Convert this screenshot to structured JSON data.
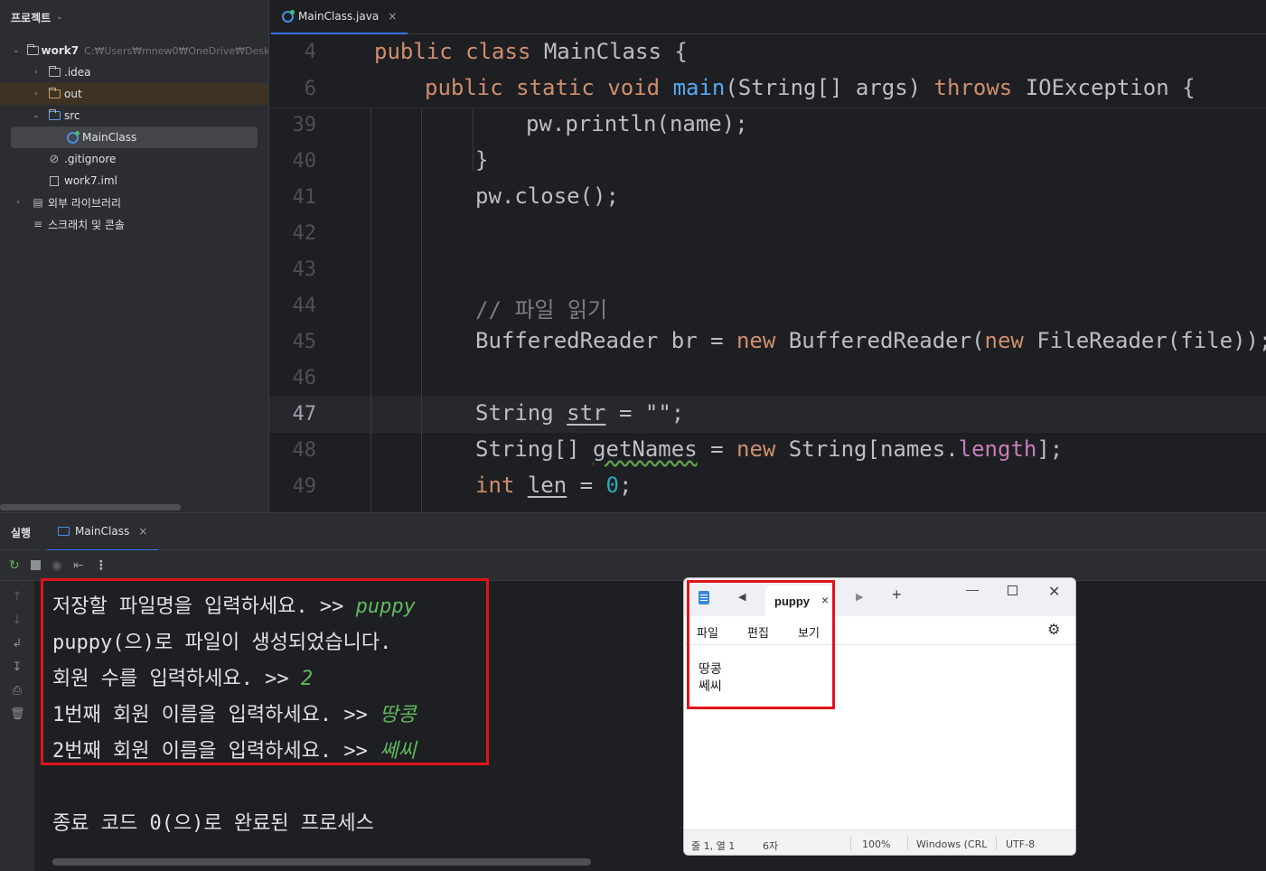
{
  "project": {
    "title": "프로젝트",
    "root_name": "work7",
    "root_path": "C:₩Users₩mnew0₩OneDrive₩Deskto",
    "items": [
      {
        "label": ".idea"
      },
      {
        "label": "out"
      },
      {
        "label": "src"
      },
      {
        "label": "MainClass"
      },
      {
        "label": ".gitignore"
      },
      {
        "label": "work7.iml"
      },
      {
        "label": "외부 라이브러리"
      },
      {
        "label": "스크래치 및 콘솔"
      }
    ]
  },
  "editor": {
    "tab": {
      "label": "MainClass.java",
      "close": "×"
    },
    "line_numbers": [
      "4",
      "6",
      "39",
      "40",
      "41",
      "42",
      "43",
      "44",
      "45",
      "46",
      "47",
      "48",
      "49"
    ],
    "current_line": "47",
    "code": {
      "l4": {
        "kw1": "public",
        "kw2": "class",
        "t1": " MainClass {"
      },
      "l6": {
        "kw1": "public",
        "kw2": "static",
        "kw3": "void",
        "fn": "main",
        "t1": "(String[] args) ",
        "kw4": "throws",
        "t2": " IOException {"
      },
      "l39": {
        "t1": "pw.println(name);"
      },
      "l40": {
        "t1": "}"
      },
      "l41": {
        "t1": "pw.close();"
      },
      "l44": {
        "cm": "// 파일 읽기"
      },
      "l45": {
        "t1": "BufferedReader br = ",
        "kw1": "new",
        "t2": " BufferedReader(",
        "kw2": "new",
        "t3": " FileReader(file));"
      },
      "l47": {
        "t1": "String ",
        "var": "str",
        "t2": " = \"\";"
      },
      "l48": {
        "t1": "String[] ",
        "var": "getNames",
        "t2": " = ",
        "kw1": "new",
        "t3": " String[names.",
        "fld": "length",
        "t4": "];"
      },
      "l49": {
        "kw1": "int",
        "t1": " ",
        "var": "len",
        "t2": " = ",
        "num": "0",
        "t3": ";"
      }
    }
  },
  "run": {
    "title": "실행",
    "tab": {
      "label": "MainClass",
      "close": "×"
    },
    "console": [
      {
        "text": "저장할 파일명을 입력하세요. >> ",
        "input": "puppy"
      },
      {
        "text": "puppy(으)로 파일이 생성되었습니다.",
        "input": ""
      },
      {
        "text": "회원 수를 입력하세요. >> ",
        "input": "2"
      },
      {
        "text": "1번째 회원 이름을 입력하세요. >> ",
        "input": "땅콩"
      },
      {
        "text": "2번째 회원 이름을 입력하세요. >> ",
        "input": "쎄씨"
      }
    ],
    "exit_message": "종료 코드 0(으)로 완료된 프로세스"
  },
  "notepad": {
    "tab_label": "puppy",
    "tab_close": "×",
    "new_tab": "+",
    "menu": [
      "파일",
      "편집",
      "보기"
    ],
    "lines": [
      "땅콩",
      "쎄씨"
    ],
    "status": {
      "position": "줄 1, 열 1",
      "chars": "6자",
      "zoom": "100%",
      "eol": "Windows (CRL",
      "encoding": "UTF-8"
    }
  },
  "colors": {
    "highlight_box": "#e0141b",
    "keyword": "#cf8e6d",
    "function": "#56a8f5",
    "input_text": "#5fb85f"
  }
}
